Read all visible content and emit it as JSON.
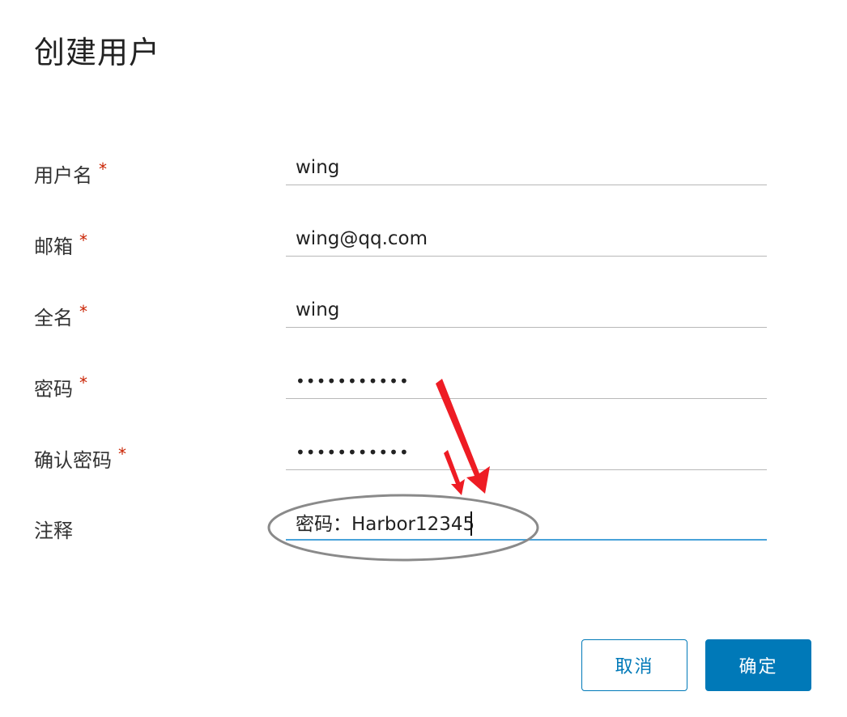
{
  "dialog": {
    "title": "创建用户"
  },
  "form": {
    "required_mark": "*",
    "fields": [
      {
        "label": "用户名",
        "value": "wing",
        "required": true,
        "type": "text"
      },
      {
        "label": "邮箱",
        "value": "wing@qq.com",
        "required": true,
        "type": "text"
      },
      {
        "label": "全名",
        "value": "wing",
        "required": true,
        "type": "text"
      },
      {
        "label": "密码",
        "value": "Harbor12345",
        "required": true,
        "type": "password"
      },
      {
        "label": "确认密码",
        "value": "Harbor12345",
        "required": true,
        "type": "password"
      },
      {
        "label": "注释",
        "value": "密码：Harbor12345",
        "required": false,
        "type": "text"
      }
    ]
  },
  "buttons": {
    "cancel_label": "取消",
    "confirm_label": "确定"
  },
  "colors": {
    "primary": "#0079b8",
    "required": "#c92100",
    "focus_underline": "#49a3da",
    "annotation_arrow": "#ee1c24"
  }
}
